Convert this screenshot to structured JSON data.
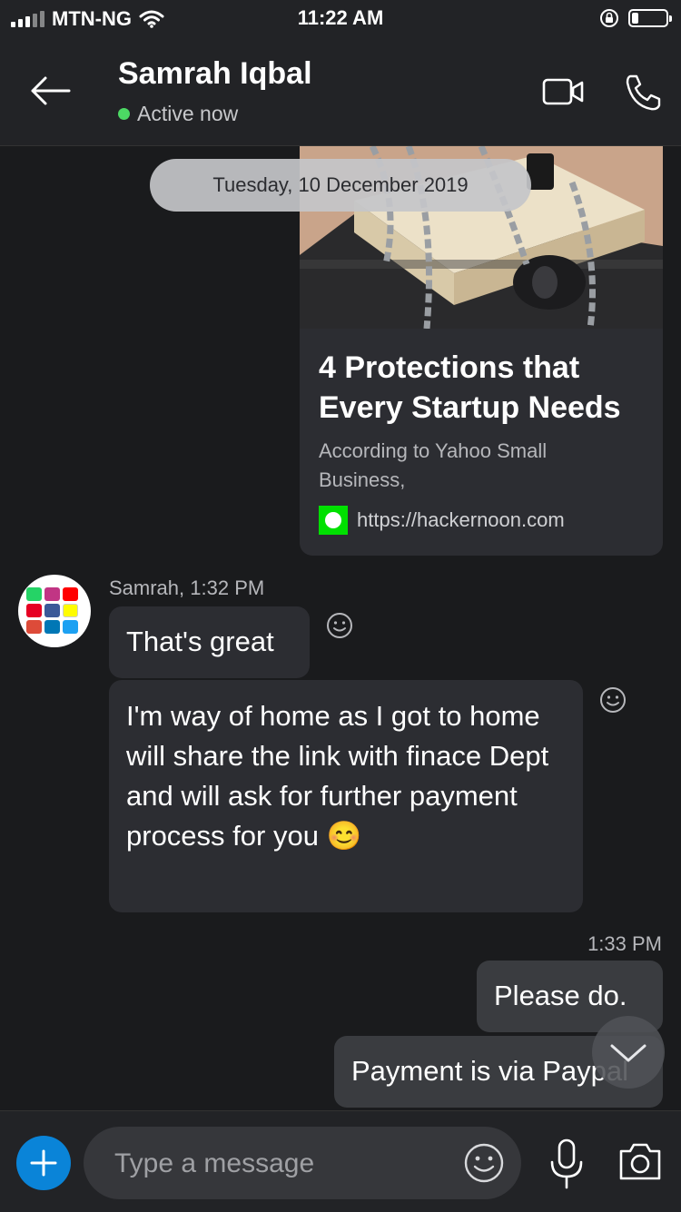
{
  "status_bar": {
    "carrier": "MTN-NG",
    "time": "11:22 AM",
    "battery_level": 0.2
  },
  "header": {
    "contact_name": "Samrah Iqbal",
    "presence": "Active now",
    "icons": [
      "back-arrow-icon",
      "video-call-icon",
      "phone-call-icon"
    ]
  },
  "chat": {
    "date_separator": "Tuesday, 10 December 2019",
    "link_card": {
      "title": "4 Protections that Every Startup Needs",
      "description": "According to Yahoo Small Business,",
      "url": "https://hackernoon.com"
    },
    "incoming": {
      "sender_meta": "Samrah, 1:32 PM",
      "messages": [
        "That's great",
        "I'm way of home as I got to home will share the link with finace Dept and will ask for further payment process for you 😊"
      ]
    },
    "outgoing": {
      "time": "1:33 PM",
      "messages": [
        "Please do.",
        "Payment is via Paypal"
      ]
    }
  },
  "composer": {
    "placeholder": "Type a message",
    "icons": [
      "plus-icon",
      "emoji-icon",
      "microphone-icon",
      "camera-icon"
    ]
  },
  "colors": {
    "background": "#1a1b1d",
    "bar": "#222326",
    "bubble_incoming": "#2c2d32",
    "bubble_outgoing": "#3a3c40",
    "accent": "#0a84d8",
    "online": "#4cd964"
  }
}
